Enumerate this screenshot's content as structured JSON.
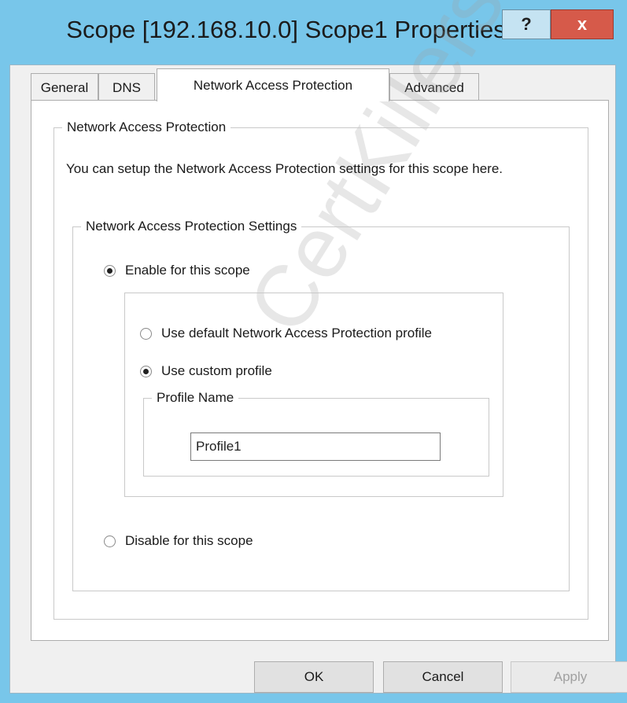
{
  "window": {
    "title": "Scope [192.168.10.0] Scope1 Properties",
    "help_glyph": "?",
    "close_glyph": "x"
  },
  "tabs": [
    {
      "label": "General",
      "active": false
    },
    {
      "label": "DNS",
      "active": false
    },
    {
      "label": "Network Access Protection",
      "active": true
    },
    {
      "label": "Advanced",
      "active": false
    }
  ],
  "nap_group": {
    "legend": "Network Access Protection",
    "description": "You can setup the Network Access Protection settings for this scope here.",
    "settings": {
      "legend": "Network Access Protection Settings",
      "enable_label": "Enable for this scope",
      "enable_checked": true,
      "default_profile_label": "Use default Network Access Protection profile",
      "default_profile_checked": false,
      "custom_profile_label": "Use custom profile",
      "custom_profile_checked": true,
      "profile_name": {
        "legend": "Profile Name",
        "value": "Profile1"
      },
      "disable_label": "Disable for this scope",
      "disable_checked": false
    }
  },
  "buttons": {
    "ok": "OK",
    "cancel": "Cancel",
    "apply": "Apply"
  },
  "watermark": "CertKillers"
}
